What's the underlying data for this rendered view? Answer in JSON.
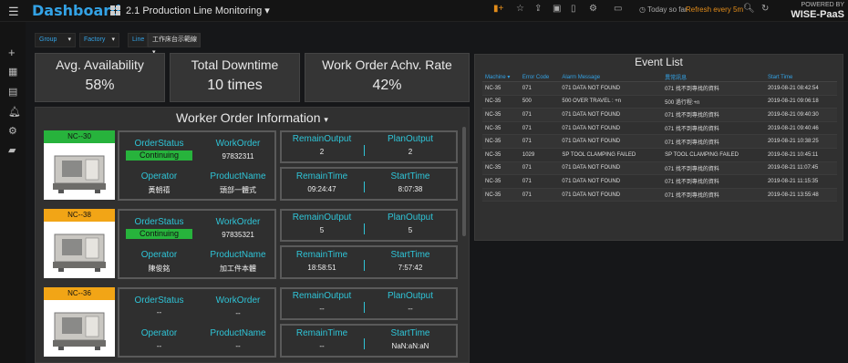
{
  "topbar": {
    "app_title": "Dashboard",
    "page_name": "2.1 Production Line Monitoring",
    "time_range": "Today so far",
    "refresh": "Refresh every 5m",
    "brand_top": "POWERED BY",
    "brand_name": "WISE-PaaS"
  },
  "filters": {
    "group_label": "Group",
    "factory_label": "Factory",
    "line_label": "Line",
    "line_value": "工作床台示範線"
  },
  "kpis": [
    {
      "title": "Avg. Availability",
      "value": "58%"
    },
    {
      "title": "Total Downtime",
      "value": "10 times"
    },
    {
      "title": "Work Order Achv. Rate",
      "value": "42%"
    }
  ],
  "work_orders": {
    "title": "Worker Order Information",
    "labels": {
      "order_status": "OrderStatus",
      "work_order": "WorkOrder",
      "operator": "Operator",
      "product_name": "ProductName",
      "remain_output": "RemainOutput",
      "plan_output": "PlanOutput",
      "remain_time": "RemainTime",
      "start_time": "StartTime"
    },
    "machines": [
      {
        "tag": "NC--30",
        "tag_color": "#27b33c",
        "status": "Continuing",
        "work_order": "97832311",
        "operator": "黃朝禧",
        "product": "頭部一體式",
        "remain_output": "2",
        "plan_output": "2",
        "remain_time": "09:24:47",
        "start_time": "8:07:38"
      },
      {
        "tag": "NC--38",
        "tag_color": "#f2a516",
        "status": "Continuing",
        "work_order": "97835321",
        "operator": "陳俊銘",
        "product": "加工件本體",
        "remain_output": "5",
        "plan_output": "5",
        "remain_time": "18:58:51",
        "start_time": "7:57:42"
      },
      {
        "tag": "NC--36",
        "tag_color": "#f2a516",
        "status": "--",
        "work_order": "--",
        "operator": "--",
        "product": "--",
        "remain_output": "--",
        "plan_output": "--",
        "remain_time": "--",
        "start_time": "NaN:aN:aN"
      }
    ]
  },
  "event_list": {
    "title": "Event List",
    "columns": [
      "Machine",
      "Error Code",
      "Alarm Message",
      "異常訊息",
      "Start Time"
    ],
    "rows": [
      [
        "NC-35",
        "071",
        "071 DATA NOT FOUND",
        "071 找不到專找的資料",
        "2019-08-21 08:42:54"
      ],
      [
        "NC-35",
        "500",
        "500 OVER TRAVEL : +n",
        "500 過行程:+n",
        "2019-08-21 09:06:18"
      ],
      [
        "NC-35",
        "071",
        "071 DATA NOT FOUND",
        "071 找不到專找的資料",
        "2019-08-21 09:40:30"
      ],
      [
        "NC-35",
        "071",
        "071 DATA NOT FOUND",
        "071 找不到專找的資料",
        "2019-08-21 09:40:46"
      ],
      [
        "NC-35",
        "071",
        "071 DATA NOT FOUND",
        "071 找不到專找的資料",
        "2019-08-21 10:38:25"
      ],
      [
        "NC-35",
        "1029",
        "SP TOOL CLAMPING FAILED",
        "SP TOOL CLAMPING FAILED",
        "2019-08-21 10:45:11"
      ],
      [
        "NC-35",
        "071",
        "071 DATA NOT FOUND",
        "071 找不到專找的資料",
        "2019-08-21 11:07:45"
      ],
      [
        "NC-35",
        "071",
        "071 DATA NOT FOUND",
        "071 找不到專找的資料",
        "2019-08-21 11:15:35"
      ],
      [
        "NC-35",
        "071",
        "071 DATA NOT FOUND",
        "071 找不到專找的資料",
        "2019-08-21 13:55:48"
      ]
    ]
  }
}
